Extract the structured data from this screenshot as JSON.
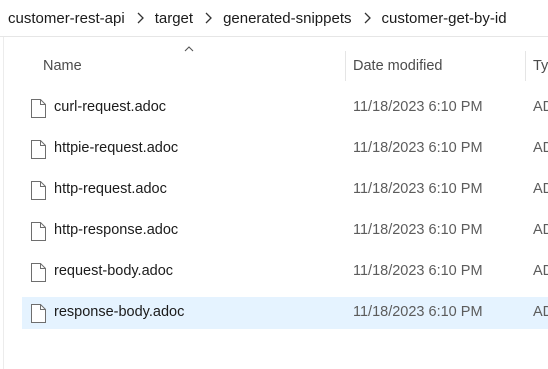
{
  "breadcrumb": {
    "items": [
      "customer-rest-api",
      "target",
      "generated-snippets",
      "customer-get-by-id"
    ],
    "separator_icon": "chevron-right-icon"
  },
  "columns": {
    "name": "Name",
    "date_modified": "Date modified",
    "type": "Ty",
    "sort_icon": "sort-ascending-icon"
  },
  "files": [
    {
      "name": "curl-request.adoc",
      "date": "11/18/2023 6:10 PM",
      "type": "AD",
      "selected": false
    },
    {
      "name": "httpie-request.adoc",
      "date": "11/18/2023 6:10 PM",
      "type": "AD",
      "selected": false
    },
    {
      "name": "http-request.adoc",
      "date": "11/18/2023 6:10 PM",
      "type": "AD",
      "selected": false
    },
    {
      "name": "http-response.adoc",
      "date": "11/18/2023 6:10 PM",
      "type": "AD",
      "selected": false
    },
    {
      "name": "request-body.adoc",
      "date": "11/18/2023 6:10 PM",
      "type": "AD",
      "selected": false
    },
    {
      "name": "response-body.adoc",
      "date": "11/18/2023 6:10 PM",
      "type": "AD",
      "selected": true
    }
  ],
  "colors": {
    "selected_row": "#e5f3ff",
    "text": "#1b1b1b",
    "muted_text": "#5c5c5c"
  }
}
